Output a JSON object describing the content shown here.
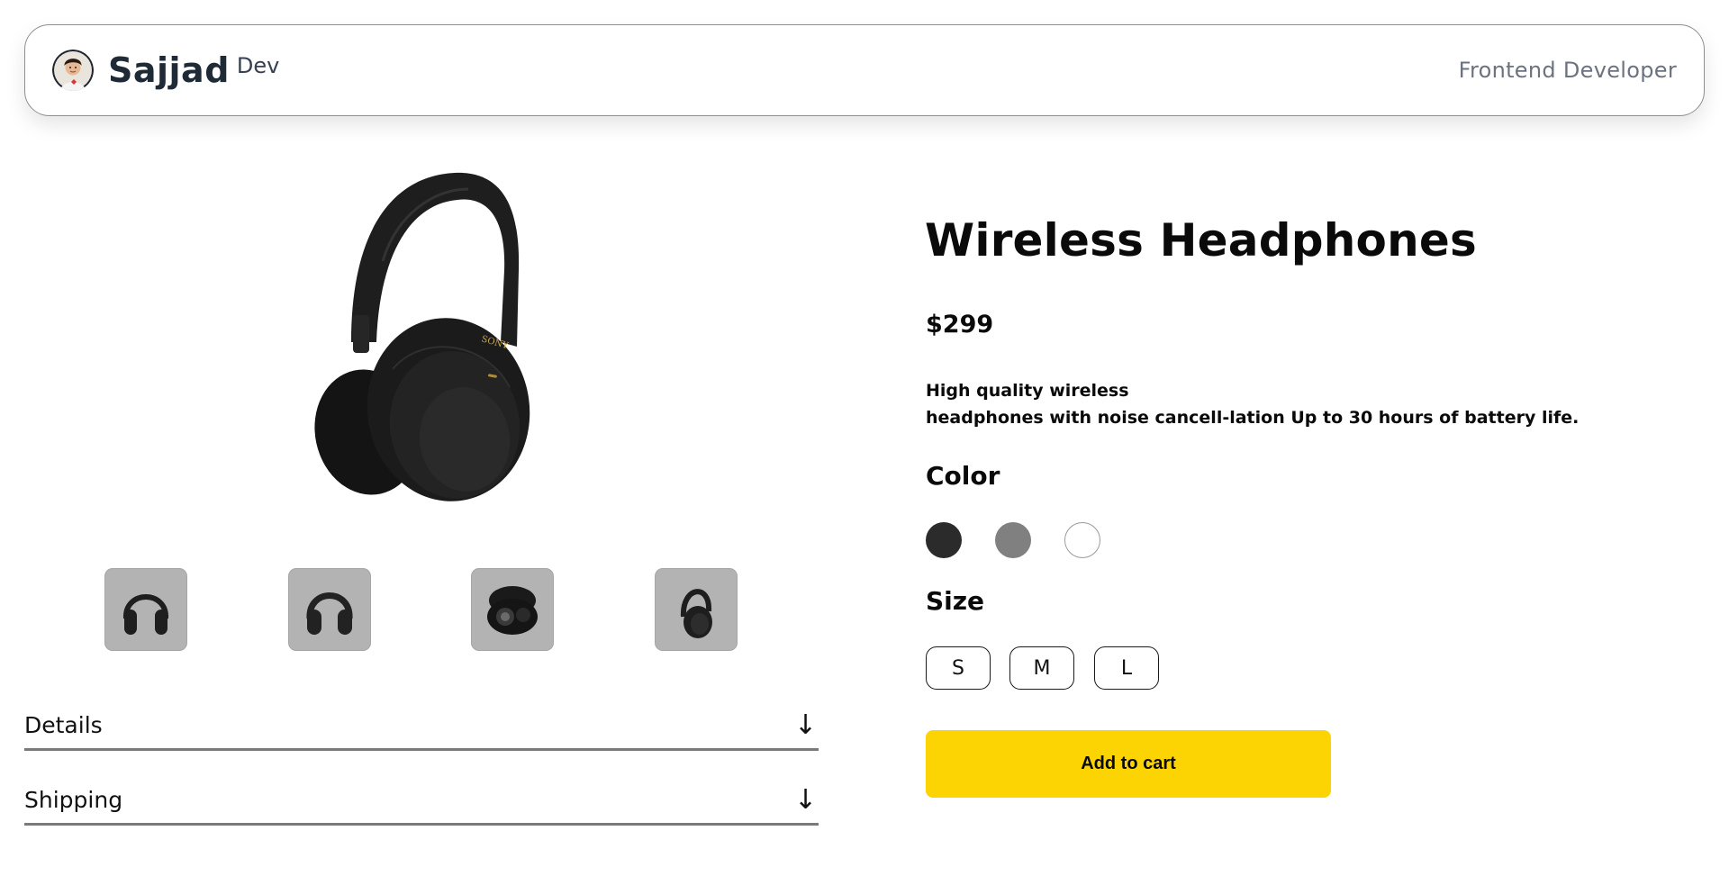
{
  "header": {
    "brand_name": "Sajjad",
    "brand_suffix": "Dev",
    "role": "Frontend Developer"
  },
  "gallery": {
    "thumbnails": [
      {
        "icon": "headphones-front-icon"
      },
      {
        "icon": "headphones-front-icon"
      },
      {
        "icon": "headphones-case-icon"
      },
      {
        "icon": "headphones-side-icon"
      }
    ]
  },
  "accordion": [
    {
      "label": "Details",
      "arrow": "↓"
    },
    {
      "label": "Shipping",
      "arrow": "↓"
    }
  ],
  "product": {
    "title": "Wireless Headphones",
    "price": "$299",
    "description_line1": "High quality wireless",
    "description_line2": "headphones with noise cancell-lation Up to 30 hours of battery life.",
    "color_label": "Color",
    "colors": [
      "#2b2b2b",
      "#808080",
      "#ffffff"
    ],
    "size_label": "Size",
    "sizes": [
      "S",
      "M",
      "L"
    ],
    "add_to_cart": "Add to cart"
  },
  "theme": {
    "accent": "#fcd404",
    "thumbnail_bg": "#b3b3b3"
  }
}
